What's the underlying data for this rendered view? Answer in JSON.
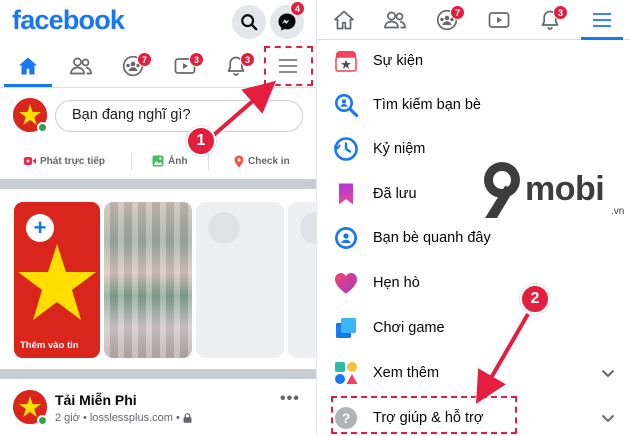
{
  "left": {
    "brand": "facebook",
    "messenger_badge": "4",
    "tabs": {
      "groups_badge": "7",
      "watch_badge": "3",
      "notifications_badge": "3"
    },
    "composer": {
      "placeholder": "Bạn đang nghĩ gì?"
    },
    "actions": {
      "live": "Phát trực tiếp",
      "photo": "Ảnh",
      "checkin": "Check in"
    },
    "stories": {
      "create_label": "Thêm vào tin"
    },
    "post": {
      "author": "Tải Miễn Phi",
      "time": "2 giờ",
      "separator": "•",
      "source": "losslessplus.com",
      "separator2": "•",
      "more": "•••"
    }
  },
  "right": {
    "tabs": {
      "groups_badge": "7",
      "notifications_badge": "3"
    },
    "menu": [
      {
        "label": "Sự kiện",
        "icon": "calendar-star-icon"
      },
      {
        "label": "Tìm kiếm bạn bè",
        "icon": "find-friends-icon"
      },
      {
        "label": "Kỷ niệm",
        "icon": "memories-clock-icon"
      },
      {
        "label": "Đã lưu",
        "icon": "bookmark-icon"
      },
      {
        "label": "Bạn bè quanh đây",
        "icon": "nearby-friends-icon"
      },
      {
        "label": "Hẹn hò",
        "icon": "heart-icon"
      },
      {
        "label": "Chơi game",
        "icon": "gaming-icon"
      },
      {
        "label": "Xem thêm",
        "icon": "shapes-icon"
      },
      {
        "label": "Trợ giúp & hỗ trợ",
        "icon": "help-question-icon"
      }
    ]
  },
  "watermark": {
    "text": "mobi",
    "sub": ".vn"
  },
  "annotations": {
    "step1": "1",
    "step2": "2"
  },
  "colors": {
    "facebook_blue": "#1877f2",
    "badge_red": "#e41e3f",
    "annotation_red": "#e41e3f"
  }
}
